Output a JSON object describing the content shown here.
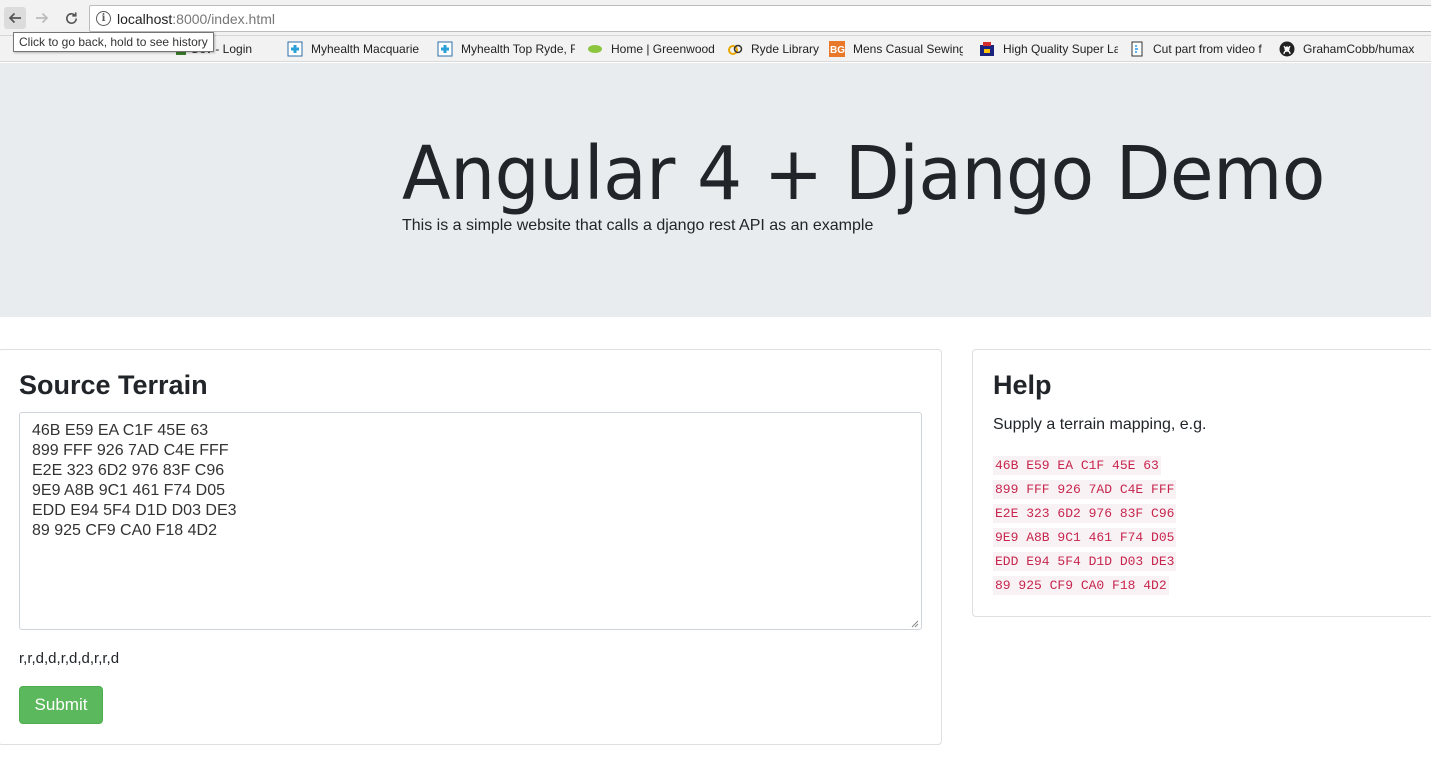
{
  "browser": {
    "url_host": "localhost",
    "url_rest": ":8000/index.html",
    "tooltip": "Click to go back, hold to see history",
    "bookmarks": [
      {
        "label": "Gov - Login",
        "icon": "gov-icon"
      },
      {
        "label": "Myhealth Macquarie",
        "icon": "medical-cross-icon"
      },
      {
        "label": "Myhealth Top Ryde, F",
        "icon": "medical-cross-icon"
      },
      {
        "label": "Home | Greenwood",
        "icon": "leaf-icon"
      },
      {
        "label": "Ryde Library",
        "icon": "library-icon"
      },
      {
        "label": "Mens Casual Sewing",
        "icon": "bg-icon"
      },
      {
        "label": "High Quality Super La",
        "icon": "shop-icon"
      },
      {
        "label": "Cut part from video f",
        "icon": "document-icon"
      },
      {
        "label": "GrahamCobb/humax",
        "icon": "github-icon"
      }
    ]
  },
  "jumbotron": {
    "title": "Angular 4 + Django Demo",
    "lead": "This is a simple website that calls a django rest API as an example"
  },
  "source_card": {
    "title": "Source Terrain",
    "terrain_value": "46B E59 EA C1F 45E 63\n899 FFF 926 7AD C4E FFF\nE2E 323 6D2 976 83F C96\n9E9 A8B 9C1 461 F74 D05\nEDD E94 5F4 D1D D03 DE3\n89 925 CF9 CA0 F18 4D2",
    "route": "r,r,d,d,r,d,d,r,r,d",
    "submit_label": "Submit"
  },
  "help_card": {
    "title": "Help",
    "text": "Supply a terrain mapping, e.g.",
    "example_lines": [
      "46B E59 EA C1F 45E 63",
      "899 FFF 926 7AD C4E FFF",
      "E2E 323 6D2 976 83F C96",
      "9E9 A8B 9C1 461 F74 D05",
      "EDD E94 5F4 D1D D03 DE3",
      "89 925 CF9 CA0 F18 4D2"
    ]
  },
  "colors": {
    "jumbotron_bg": "#e9ecef",
    "submit_green": "#5cb85c",
    "code_red": "#c7254e"
  }
}
